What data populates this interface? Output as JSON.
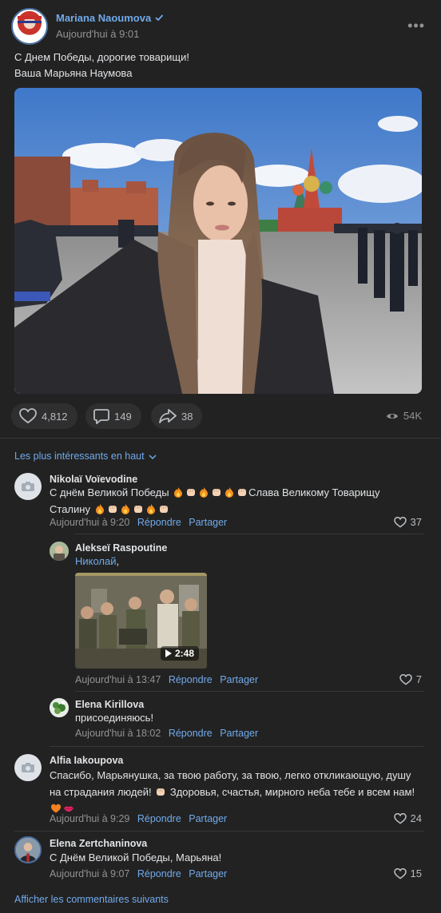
{
  "post": {
    "author": "Mariana Naoumova",
    "time": "Aujourd'hui à 9:01",
    "text_line1": "С Днем Победы, дорогие товарищи!",
    "text_line2": "Ваша Марьяна Наумова",
    "likes": "4,812",
    "comments": "149",
    "shares": "38",
    "views": "54K",
    "more_label": "•••"
  },
  "comments_section": {
    "sort_label": "Les plus intéressants en haut",
    "show_more_label": "Afficher les commentaires suivants",
    "reply_label": "Répondre",
    "share_label": "Partager"
  },
  "comments": [
    {
      "name": "Nikolaï Voïevodine",
      "text_a": "С днём Великой Победы",
      "text_b": "Слава Великому Товарищу",
      "text_c": "Сталину",
      "time": "Aujourd'hui à 9:20",
      "likes": "37"
    },
    {
      "name": "Alfia Iakoupova",
      "text_line1": "Спасибо, Марьянушка, за твою работу, за твою, легко откликающую, душу",
      "text_line2_a": "на страдания людей!",
      "text_line2_b": "Здоровья, счастья, мирного неба тебе и всем нам!",
      "time": "Aujourd'hui à 9:29",
      "likes": "24"
    },
    {
      "name": "Elena Zertchaninova",
      "text": "С Днём Великой Победы, Марьяна!",
      "time": "Aujourd'hui à 9:07",
      "likes": "15"
    }
  ],
  "replies": [
    {
      "name": "Alekseï Raspoutine",
      "mention": "Николай",
      "mention_suffix": ",",
      "video_duration": "2:48",
      "time": "Aujourd'hui à 13:47",
      "likes": "7"
    },
    {
      "name": "Elena Kirillova",
      "text": "присоединяюсь!",
      "time": "Aujourd'hui à 18:02"
    }
  ],
  "colors": {
    "background": "#222222",
    "link": "#71aaeb",
    "muted": "#939393",
    "text": "#e1e3e6",
    "button_bg": "#2f2f2f"
  }
}
